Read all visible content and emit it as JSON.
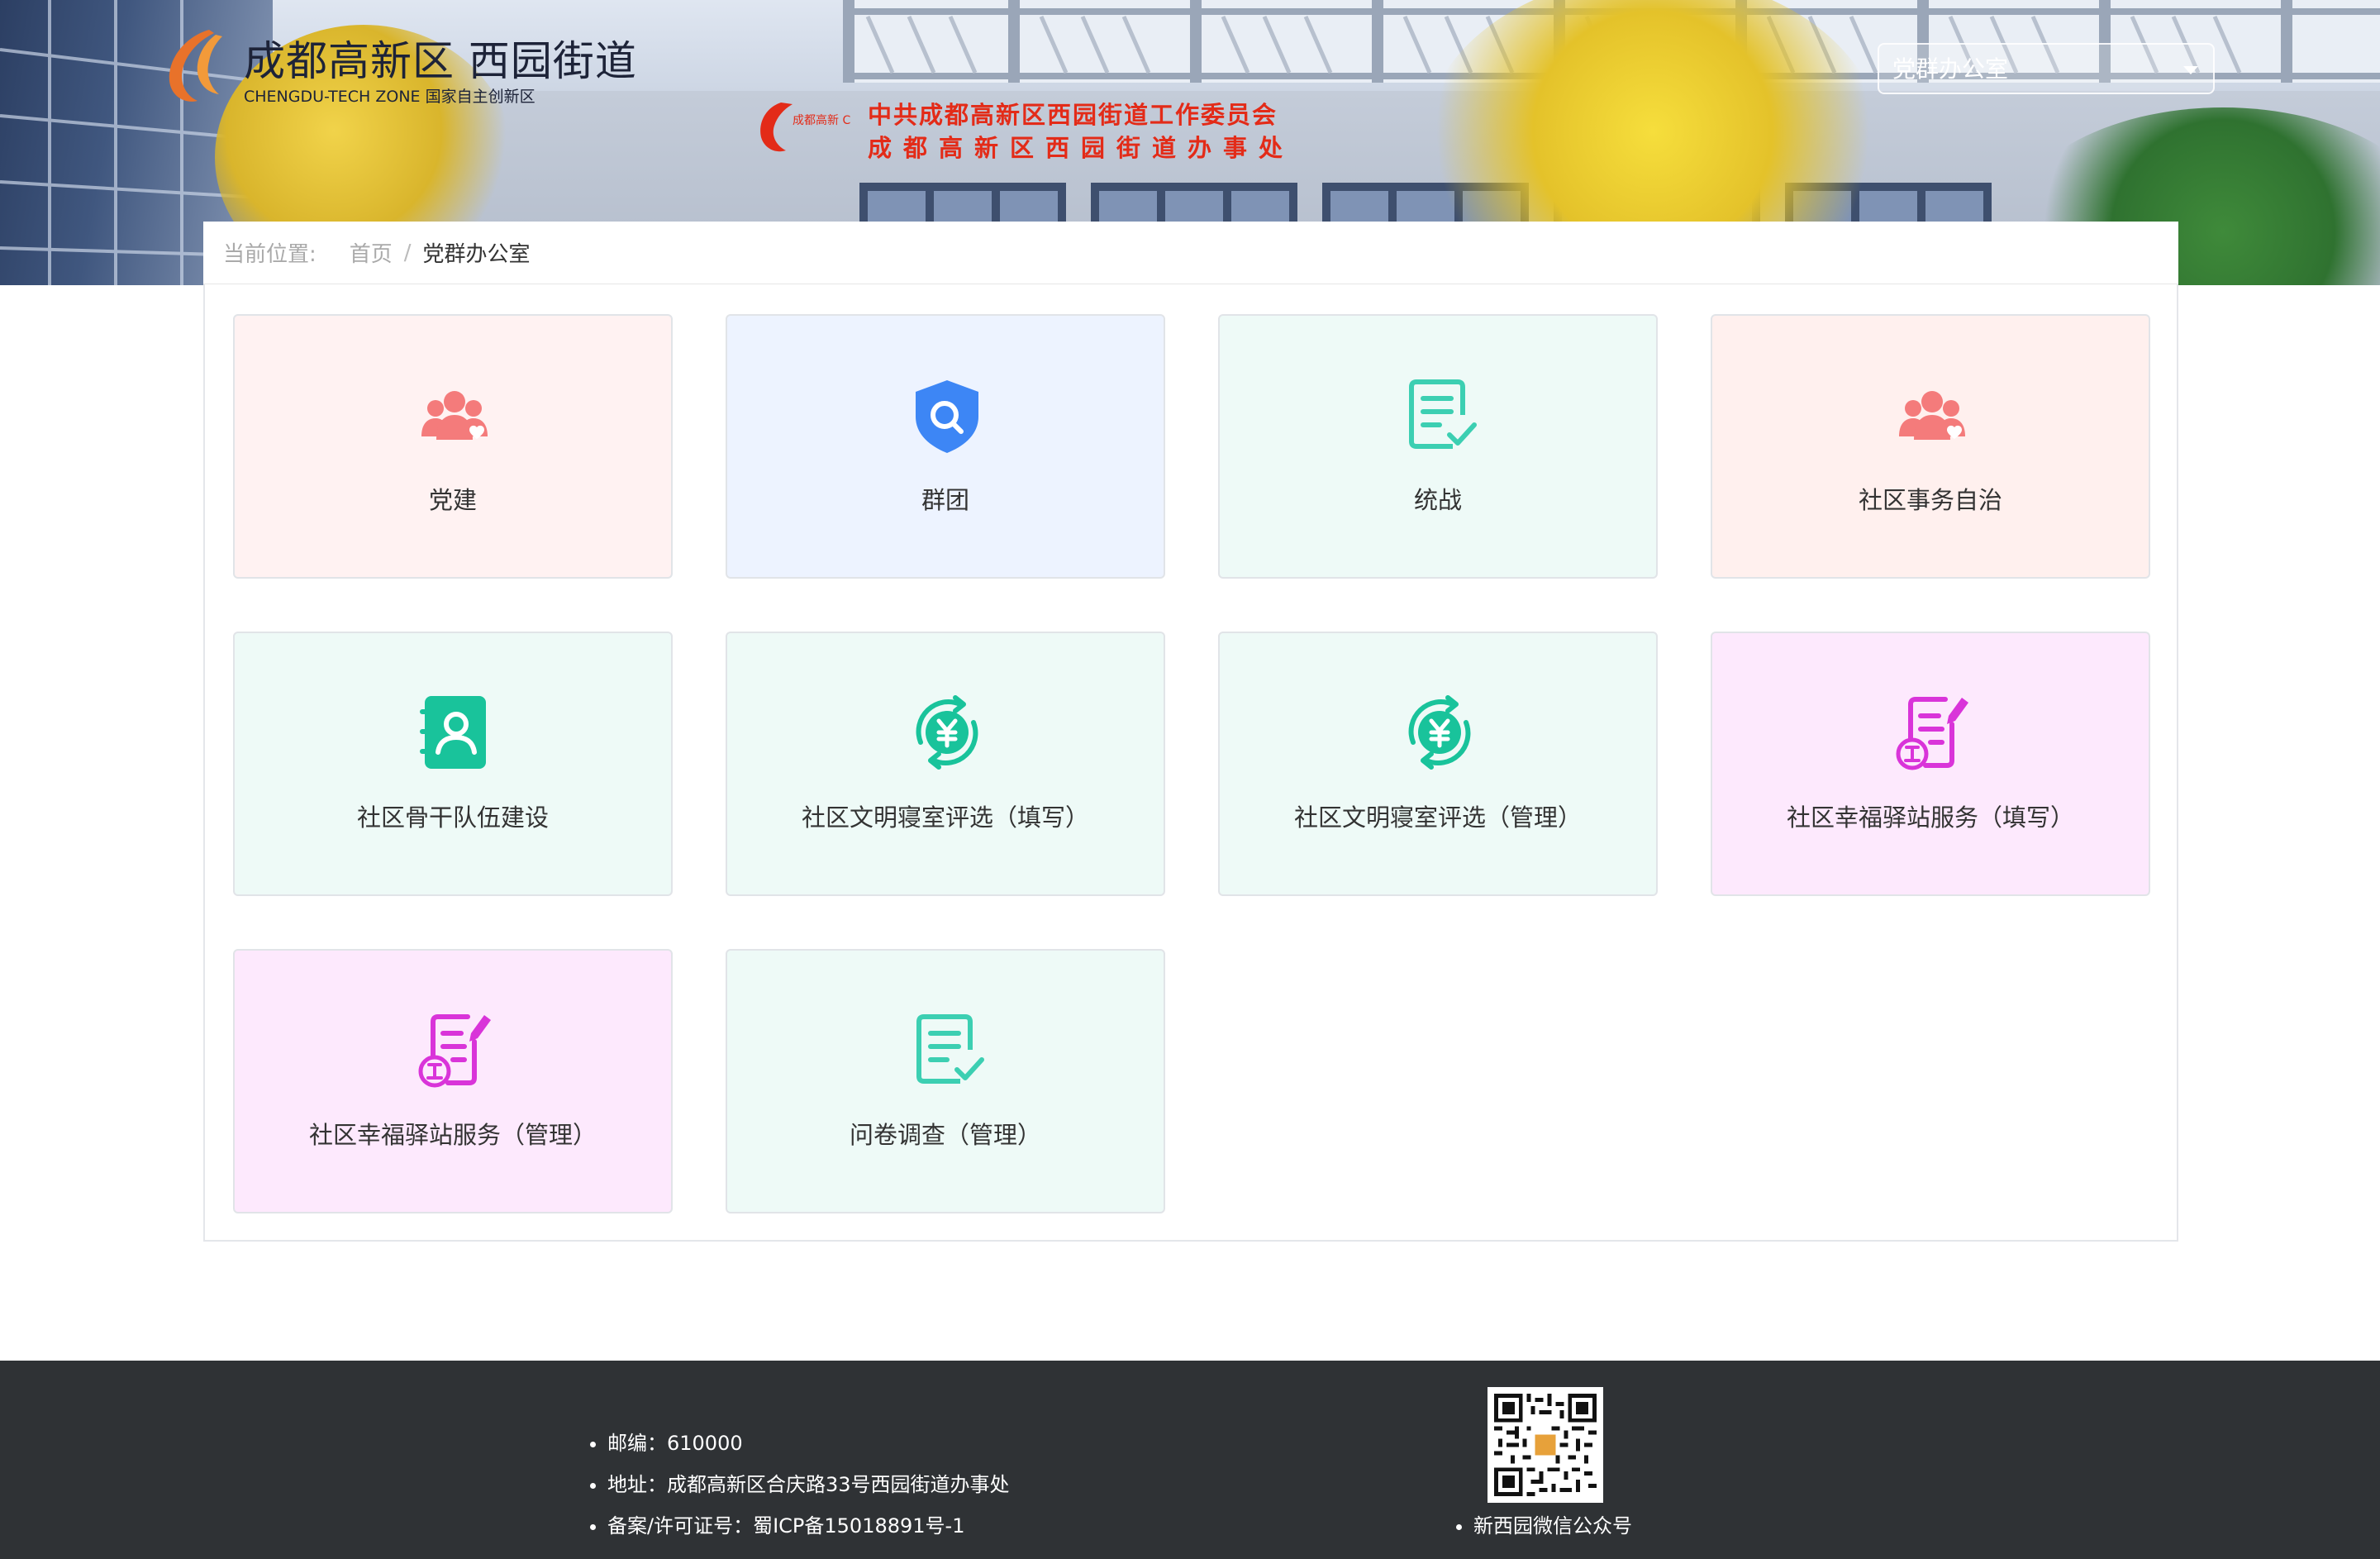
{
  "header": {
    "logo_title": "成都高新区 西园街道",
    "logo_subtitle": "CHENGDU-TECH ZONE  国家自主创新区",
    "org_mark_text": "成都高新 CDHT",
    "org_line1": "中共成都高新区西园街道工作委员会",
    "org_line2": "成都高新区西园街道办事处",
    "dept_select": {
      "value": "党群办公室"
    }
  },
  "breadcrumb": {
    "prefix": "当前位置:",
    "home": "首页",
    "separator": "/",
    "current": "党群办公室"
  },
  "cards": [
    {
      "label": "党建",
      "icon": "group-icon",
      "color": "#f47b7b",
      "bg": "#fff2f2"
    },
    {
      "label": "群团",
      "icon": "shield-search-icon",
      "color": "#3d86f5",
      "bg": "#edf3ff"
    },
    {
      "label": "统战",
      "icon": "checklist-icon",
      "color": "#3ccfb2",
      "bg": "#eefaf7"
    },
    {
      "label": "社区事务自治",
      "icon": "group-icon",
      "color": "#f47b7b",
      "bg": "#fff0ee"
    },
    {
      "label": "社区骨干队伍建设",
      "icon": "contact-book-icon",
      "color": "#19c39b",
      "bg": "#eefaf7"
    },
    {
      "label": "社区文明寝室评选（填写）",
      "icon": "yuan-cycle-icon",
      "color": "#19c39b",
      "bg": "#eefaf7"
    },
    {
      "label": "社区文明寝室评选（管理）",
      "icon": "yuan-cycle-icon",
      "color": "#19c39b",
      "bg": "#eefaf7"
    },
    {
      "label": "社区幸福驿站服务（填写）",
      "icon": "work-form-icon",
      "color": "#d934d9",
      "bg": "#fde9fd"
    },
    {
      "label": "社区幸福驿站服务（管理）",
      "icon": "work-form-icon",
      "color": "#d934d9",
      "bg": "#fde9fd"
    },
    {
      "label": "问卷调查（管理）",
      "icon": "checklist-icon",
      "color": "#3ccfb2",
      "bg": "#eefaf7"
    }
  ],
  "footer": {
    "postcode": "邮编：610000",
    "address": "地址：成都高新区合庆路33号西园街道办事处",
    "icp": "备案/许可证号：蜀ICP备15018891号-1",
    "qr_caption": "新西园微信公众号"
  }
}
